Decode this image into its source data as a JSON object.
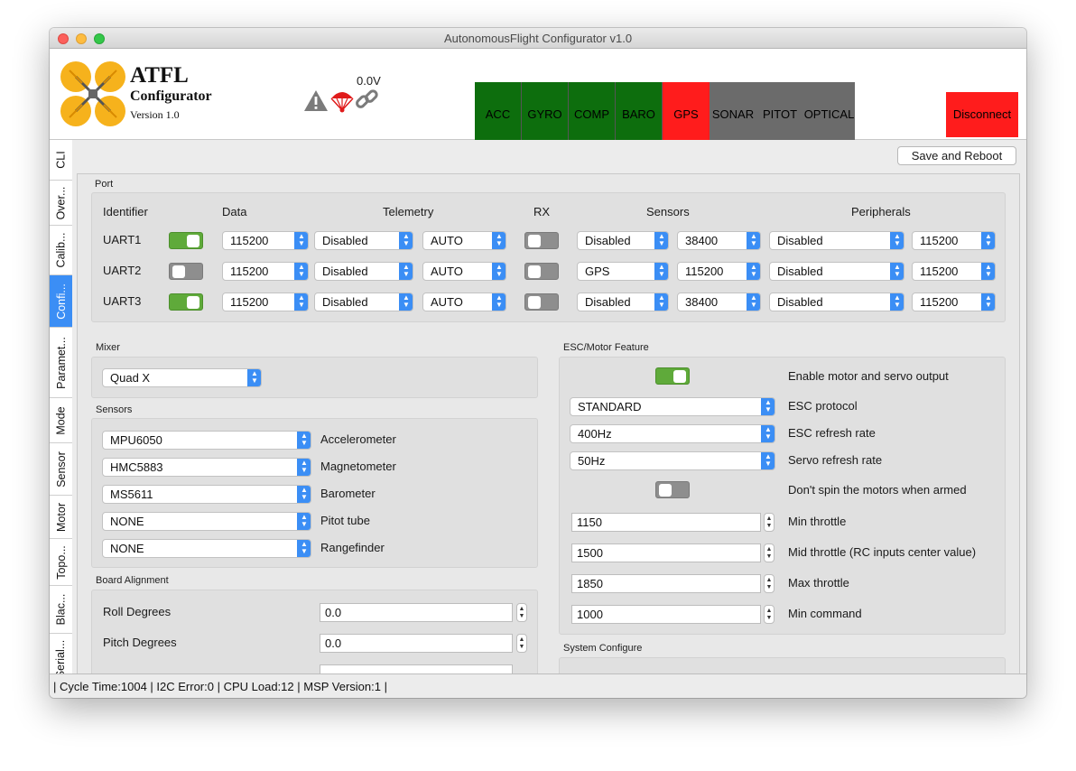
{
  "window": {
    "title": "AutonomousFlight Configurator v1.0"
  },
  "header": {
    "brand_title": "ATFL",
    "brand_subtitle": "Configurator",
    "brand_version": "Version 1.0",
    "voltage": "0.0V",
    "sensors": [
      {
        "label": "ACC",
        "state": "ok"
      },
      {
        "label": "GYRO",
        "state": "ok"
      },
      {
        "label": "COMP",
        "state": "ok"
      },
      {
        "label": "BARO",
        "state": "ok"
      },
      {
        "label": "GPS",
        "state": "error"
      },
      {
        "label": "SONAR",
        "state": "off"
      },
      {
        "label": "PITOT",
        "state": "off"
      },
      {
        "label": "OPTICAL",
        "state": "off"
      }
    ],
    "disconnect_label": "Disconnect",
    "colors": {
      "ok": "#0d6e0d",
      "error": "#ff1c1c",
      "off": "#6b6b6b"
    }
  },
  "tabs": [
    "CLI",
    "Over...",
    "Calib...",
    "Confi...",
    "Paramet...",
    "Mode",
    "Sensor",
    "Motor",
    "Topo...",
    "Blac...",
    "Serial..."
  ],
  "active_tab": "Confi...",
  "toolbar": {
    "save_reboot_label": "Save and Reboot"
  },
  "port": {
    "section_label": "Port",
    "headers": {
      "identifier": "Identifier",
      "data": "Data",
      "telemetry": "Telemetry",
      "rx": "RX",
      "sensors": "Sensors",
      "peripherals": "Peripherals"
    },
    "rows": [
      {
        "id": "UART1",
        "enabled": true,
        "data_baud": "115200",
        "telemetry": "Disabled",
        "telemetry_baud": "AUTO",
        "rx": false,
        "sensor": "Disabled",
        "sensor_baud": "38400",
        "peripheral": "Disabled",
        "peripheral_baud": "115200"
      },
      {
        "id": "UART2",
        "enabled": false,
        "data_baud": "115200",
        "telemetry": "Disabled",
        "telemetry_baud": "AUTO",
        "rx": false,
        "sensor": "GPS",
        "sensor_baud": "115200",
        "peripheral": "Disabled",
        "peripheral_baud": "115200"
      },
      {
        "id": "UART3",
        "enabled": true,
        "data_baud": "115200",
        "telemetry": "Disabled",
        "telemetry_baud": "AUTO",
        "rx": false,
        "sensor": "Disabled",
        "sensor_baud": "38400",
        "peripheral": "Disabled",
        "peripheral_baud": "115200"
      }
    ]
  },
  "mixer": {
    "section_label": "Mixer",
    "value": "Quad X"
  },
  "sensors_section": {
    "section_label": "Sensors",
    "items": [
      {
        "value": "MPU6050",
        "label": "Accelerometer"
      },
      {
        "value": "HMC5883",
        "label": "Magnetometer"
      },
      {
        "value": "MS5611",
        "label": "Barometer"
      },
      {
        "value": "NONE",
        "label": "Pitot tube"
      },
      {
        "value": "NONE",
        "label": "Rangefinder"
      }
    ]
  },
  "board_alignment": {
    "section_label": "Board Alignment",
    "items": [
      {
        "label": "Roll Degrees",
        "value": "0.0"
      },
      {
        "label": "Pitch Degrees",
        "value": "0.0"
      }
    ]
  },
  "esc": {
    "section_label": "ESC/Motor Feature",
    "enable_label": "Enable motor and servo output",
    "enable": true,
    "protocol": {
      "value": "STANDARD",
      "label": "ESC protocol"
    },
    "refresh": {
      "value": "400Hz",
      "label": "ESC refresh rate"
    },
    "servo": {
      "value": "50Hz",
      "label": "Servo refresh rate"
    },
    "dont_spin_label": "Don't spin the motors when armed",
    "dont_spin": false,
    "min_throttle": {
      "value": "1150",
      "label": "Min throttle"
    },
    "mid_throttle": {
      "value": "1500",
      "label": "Mid throttle (RC inputs center value)"
    },
    "max_throttle": {
      "value": "1850",
      "label": "Max throttle"
    },
    "min_command": {
      "value": "1000",
      "label": "Min command"
    }
  },
  "system_configure": {
    "section_label": "System Configure"
  },
  "statusbar": {
    "text": "| Cycle Time:1004 | I2C Error:0 | CPU Load:12 | MSP Version:1 |"
  }
}
